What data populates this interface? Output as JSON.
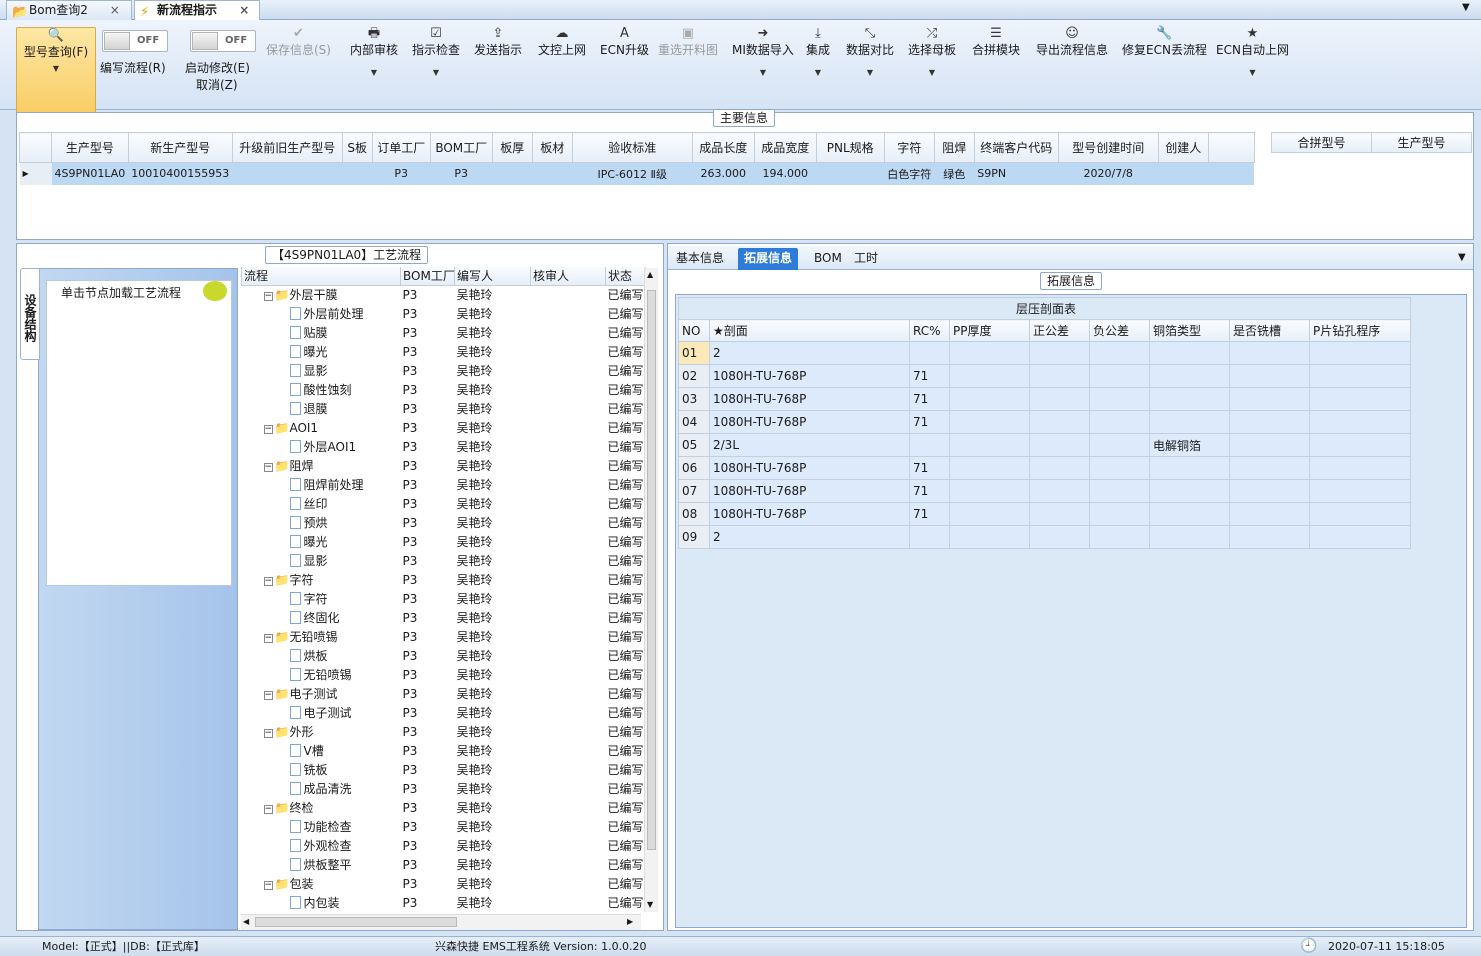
{
  "tabs": [
    {
      "label": "Bom查询2",
      "icon": "folder-icon"
    },
    {
      "label": "新流程指示",
      "icon": "lightning-icon"
    }
  ],
  "ribbon": {
    "query": {
      "label": "型号查询(F)"
    },
    "toggle1": {
      "state": "OFF",
      "label": "编写流程(R)"
    },
    "toggle2": {
      "state": "OFF",
      "label": "启动修改(E)",
      "sub": "取消(Z)"
    },
    "buttons": [
      {
        "label": "保存信息(S)",
        "icon": "check-icon",
        "disabled": true,
        "dropdown": false
      },
      {
        "label": "内部审核",
        "icon": "print-icon",
        "disabled": false,
        "dropdown": true
      },
      {
        "label": "指示检查",
        "icon": "checkbox-icon",
        "disabled": false,
        "dropdown": true
      },
      {
        "label": "发送指示",
        "icon": "upload-icon",
        "disabled": false,
        "dropdown": false
      },
      {
        "label": "文控上网",
        "icon": "cloud-upload-icon",
        "disabled": false,
        "dropdown": false
      },
      {
        "label": "ECN升级",
        "icon": "font-icon",
        "disabled": false,
        "dropdown": false
      },
      {
        "label": "重选开料图",
        "icon": "image-icon",
        "disabled": true,
        "dropdown": false
      },
      {
        "label": "MI数据导入",
        "icon": "login-icon",
        "disabled": false,
        "dropdown": true
      },
      {
        "label": "集成",
        "icon": "download-icon",
        "disabled": false,
        "dropdown": true
      },
      {
        "label": "数据对比",
        "icon": "compress-icon",
        "disabled": false,
        "dropdown": true
      },
      {
        "label": "选择母板",
        "icon": "shuffle-icon",
        "disabled": false,
        "dropdown": true
      },
      {
        "label": "合拼模块",
        "icon": "list-icon",
        "disabled": false,
        "dropdown": false
      },
      {
        "label": "导出流程信息",
        "icon": "smile-icon",
        "disabled": false,
        "dropdown": false
      },
      {
        "label": "修复ECN丢流程",
        "icon": "wrench-icon",
        "disabled": false,
        "dropdown": false
      },
      {
        "label": "ECN自动上网",
        "icon": "star-icon",
        "disabled": false,
        "dropdown": true
      }
    ]
  },
  "main_info": {
    "title": "主要信息",
    "columns": [
      "生产型号",
      "新生产型号",
      "升级前旧生产型号",
      "S板",
      "订单工厂",
      "BOM工厂",
      "板厚",
      "板材",
      "验收标准",
      "成品长度",
      "成品宽度",
      "PNL规格",
      "字符",
      "阻焊",
      "终端客户代码",
      "型号创建时间",
      "创建人"
    ],
    "row": [
      "4S9PN01LA0",
      "10010400155953",
      "",
      "",
      "P3",
      "P3",
      "",
      "",
      "IPC-6012 Ⅱ级",
      "263.000",
      "194.000",
      "",
      "白色字符",
      "绿色",
      "S9PN",
      "2020/7/8",
      ""
    ],
    "merge_columns": [
      "合拼型号",
      "生产型号"
    ]
  },
  "flow_panel": {
    "title": "【4S9PN01LA0】工艺流程",
    "side_tab": "设备结构",
    "hint": "单击节点加载工艺流程",
    "columns": [
      "流程",
      "BOM工厂",
      "编写人",
      "核审人",
      "状态"
    ],
    "rows": [
      {
        "name": "外层干膜",
        "level": 1,
        "folder": true,
        "bom": "P3",
        "author": "吴艳玲",
        "status": "已编写"
      },
      {
        "name": "外层前处理",
        "level": 2,
        "folder": false,
        "bom": "P3",
        "author": "吴艳玲",
        "status": "已编写"
      },
      {
        "name": "贴膜",
        "level": 2,
        "folder": false,
        "bom": "P3",
        "author": "吴艳玲",
        "status": "已编写"
      },
      {
        "name": "曝光",
        "level": 2,
        "folder": false,
        "bom": "P3",
        "author": "吴艳玲",
        "status": "已编写"
      },
      {
        "name": "显影",
        "level": 2,
        "folder": false,
        "bom": "P3",
        "author": "吴艳玲",
        "status": "已编写"
      },
      {
        "name": "酸性蚀刻",
        "level": 2,
        "folder": false,
        "bom": "P3",
        "author": "吴艳玲",
        "status": "已编写"
      },
      {
        "name": "退膜",
        "level": 2,
        "folder": false,
        "bom": "P3",
        "author": "吴艳玲",
        "status": "已编写"
      },
      {
        "name": "AOI1",
        "level": 1,
        "folder": true,
        "bom": "P3",
        "author": "吴艳玲",
        "status": "已编写"
      },
      {
        "name": "外层AOI1",
        "level": 2,
        "folder": false,
        "bom": "P3",
        "author": "吴艳玲",
        "status": "已编写"
      },
      {
        "name": "阻焊",
        "level": 1,
        "folder": true,
        "bom": "P3",
        "author": "吴艳玲",
        "status": "已编写"
      },
      {
        "name": "阻焊前处理",
        "level": 2,
        "folder": false,
        "bom": "P3",
        "author": "吴艳玲",
        "status": "已编写"
      },
      {
        "name": "丝印",
        "level": 2,
        "folder": false,
        "bom": "P3",
        "author": "吴艳玲",
        "status": "已编写"
      },
      {
        "name": "预烘",
        "level": 2,
        "folder": false,
        "bom": "P3",
        "author": "吴艳玲",
        "status": "已编写"
      },
      {
        "name": "曝光",
        "level": 2,
        "folder": false,
        "bom": "P3",
        "author": "吴艳玲",
        "status": "已编写"
      },
      {
        "name": "显影",
        "level": 2,
        "folder": false,
        "bom": "P3",
        "author": "吴艳玲",
        "status": "已编写"
      },
      {
        "name": "字符",
        "level": 1,
        "folder": true,
        "bom": "P3",
        "author": "吴艳玲",
        "status": "已编写"
      },
      {
        "name": "字符",
        "level": 2,
        "folder": false,
        "bom": "P3",
        "author": "吴艳玲",
        "status": "已编写"
      },
      {
        "name": "终固化",
        "level": 2,
        "folder": false,
        "bom": "P3",
        "author": "吴艳玲",
        "status": "已编写"
      },
      {
        "name": "无铅喷锡",
        "level": 1,
        "folder": true,
        "bom": "P3",
        "author": "吴艳玲",
        "status": "已编写"
      },
      {
        "name": "烘板",
        "level": 2,
        "folder": false,
        "bom": "P3",
        "author": "吴艳玲",
        "status": "已编写"
      },
      {
        "name": "无铅喷锡",
        "level": 2,
        "folder": false,
        "bom": "P3",
        "author": "吴艳玲",
        "status": "已编写"
      },
      {
        "name": "电子测试",
        "level": 1,
        "folder": true,
        "bom": "P3",
        "author": "吴艳玲",
        "status": "已编写"
      },
      {
        "name": "电子测试",
        "level": 2,
        "folder": false,
        "bom": "P3",
        "author": "吴艳玲",
        "status": "已编写"
      },
      {
        "name": "外形",
        "level": 1,
        "folder": true,
        "bom": "P3",
        "author": "吴艳玲",
        "status": "已编写"
      },
      {
        "name": "V槽",
        "level": 2,
        "folder": false,
        "bom": "P3",
        "author": "吴艳玲",
        "status": "已编写"
      },
      {
        "name": "铣板",
        "level": 2,
        "folder": false,
        "bom": "P3",
        "author": "吴艳玲",
        "status": "已编写"
      },
      {
        "name": "成品清洗",
        "level": 2,
        "folder": false,
        "bom": "P3",
        "author": "吴艳玲",
        "status": "已编写"
      },
      {
        "name": "终检",
        "level": 1,
        "folder": true,
        "bom": "P3",
        "author": "吴艳玲",
        "status": "已编写"
      },
      {
        "name": "功能检查",
        "level": 2,
        "folder": false,
        "bom": "P3",
        "author": "吴艳玲",
        "status": "已编写"
      },
      {
        "name": "外观检查",
        "level": 2,
        "folder": false,
        "bom": "P3",
        "author": "吴艳玲",
        "status": "已编写"
      },
      {
        "name": "烘板整平",
        "level": 2,
        "folder": false,
        "bom": "P3",
        "author": "吴艳玲",
        "status": "已编写"
      },
      {
        "name": "包装",
        "level": 1,
        "folder": true,
        "bom": "P3",
        "author": "吴艳玲",
        "status": "已编写"
      },
      {
        "name": "内包装",
        "level": 2,
        "folder": false,
        "bom": "P3",
        "author": "吴艳玲",
        "status": "已编写"
      }
    ]
  },
  "detail_panel": {
    "tabs": [
      "基本信息",
      "拓展信息",
      "BOM",
      "工时"
    ],
    "active_tab": "拓展信息",
    "group_title": "拓展信息",
    "table_caption": "层压剖面表",
    "columns": [
      "NO",
      "★剖面",
      "RC%",
      "PP厚度",
      "正公差",
      "负公差",
      "铜箔类型",
      "是否铣槽",
      "P片钻孔程序"
    ],
    "rows": [
      [
        "01",
        "2",
        "",
        "",
        "",
        "",
        "",
        "",
        ""
      ],
      [
        "02",
        "1080H-TU-768P",
        "71",
        "",
        "",
        "",
        "",
        "",
        ""
      ],
      [
        "03",
        "1080H-TU-768P",
        "71",
        "",
        "",
        "",
        "",
        "",
        ""
      ],
      [
        "04",
        "1080H-TU-768P",
        "71",
        "",
        "",
        "",
        "",
        "",
        ""
      ],
      [
        "05",
        "2/3L",
        "",
        "",
        "",
        "",
        "电解铜箔",
        "",
        ""
      ],
      [
        "06",
        "1080H-TU-768P",
        "71",
        "",
        "",
        "",
        "",
        "",
        ""
      ],
      [
        "07",
        "1080H-TU-768P",
        "71",
        "",
        "",
        "",
        "",
        "",
        ""
      ],
      [
        "08",
        "1080H-TU-768P",
        "71",
        "",
        "",
        "",
        "",
        "",
        ""
      ],
      [
        "09",
        "2",
        "",
        "",
        "",
        "",
        "",
        "",
        ""
      ]
    ]
  },
  "status_bar": {
    "left": "Model:【正式】||DB:【正式库】",
    "center": "兴森快捷 EMS工程系统 Version: 1.0.0.20",
    "right": "2020-07-11 15:18:05"
  },
  "colors": {
    "accent": "#2f7bd9",
    "selected_row": "#bcd8f3",
    "query_button": "#f9cd66"
  }
}
